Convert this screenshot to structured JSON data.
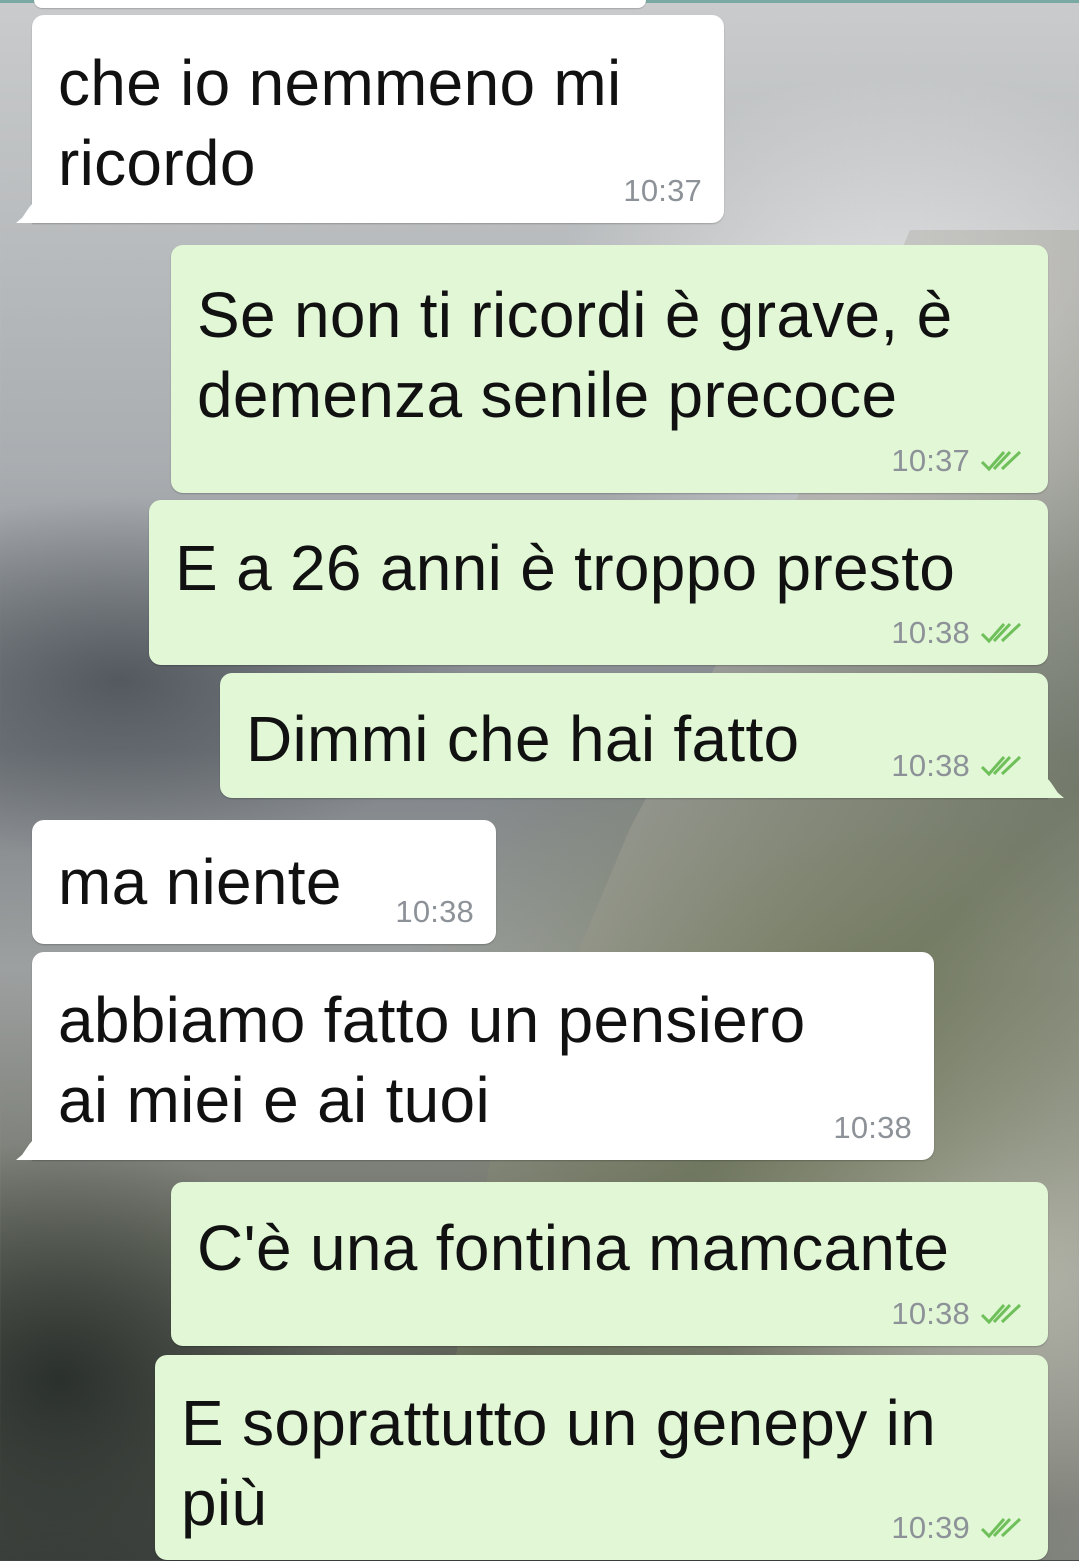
{
  "chat": {
    "messages": [
      {
        "direction": "incoming",
        "text": "che io nemmeno mi\nricordo",
        "time": "10:37"
      },
      {
        "direction": "outgoing",
        "text": "Se non ti ricordi è grave, è\ndemenza senile precoce",
        "time": "10:37",
        "status_icon": "double-check-icon"
      },
      {
        "direction": "outgoing",
        "text": "E a 26 anni è troppo presto",
        "time": "10:38",
        "status_icon": "double-check-icon"
      },
      {
        "direction": "outgoing",
        "text": "Dimmi che hai fatto",
        "time": "10:38",
        "status_icon": "double-check-icon"
      },
      {
        "direction": "incoming",
        "text": "ma niente",
        "time": "10:38"
      },
      {
        "direction": "incoming",
        "text": "abbiamo fatto un pensiero\nai miei e ai tuoi",
        "time": "10:38"
      },
      {
        "direction": "outgoing",
        "text": "C'è una fontina mamcante",
        "time": "10:38",
        "status_icon": "double-check-icon"
      },
      {
        "direction": "outgoing",
        "text": "E soprattutto un genepy in\npiù",
        "time": "10:39",
        "status_icon": "double-check-icon"
      }
    ]
  },
  "colors": {
    "incoming_bubble": "#ffffff",
    "outgoing_bubble": "#e1f7d6",
    "read_ticks": "#6fbf5a",
    "timestamp": "#8d9298"
  }
}
